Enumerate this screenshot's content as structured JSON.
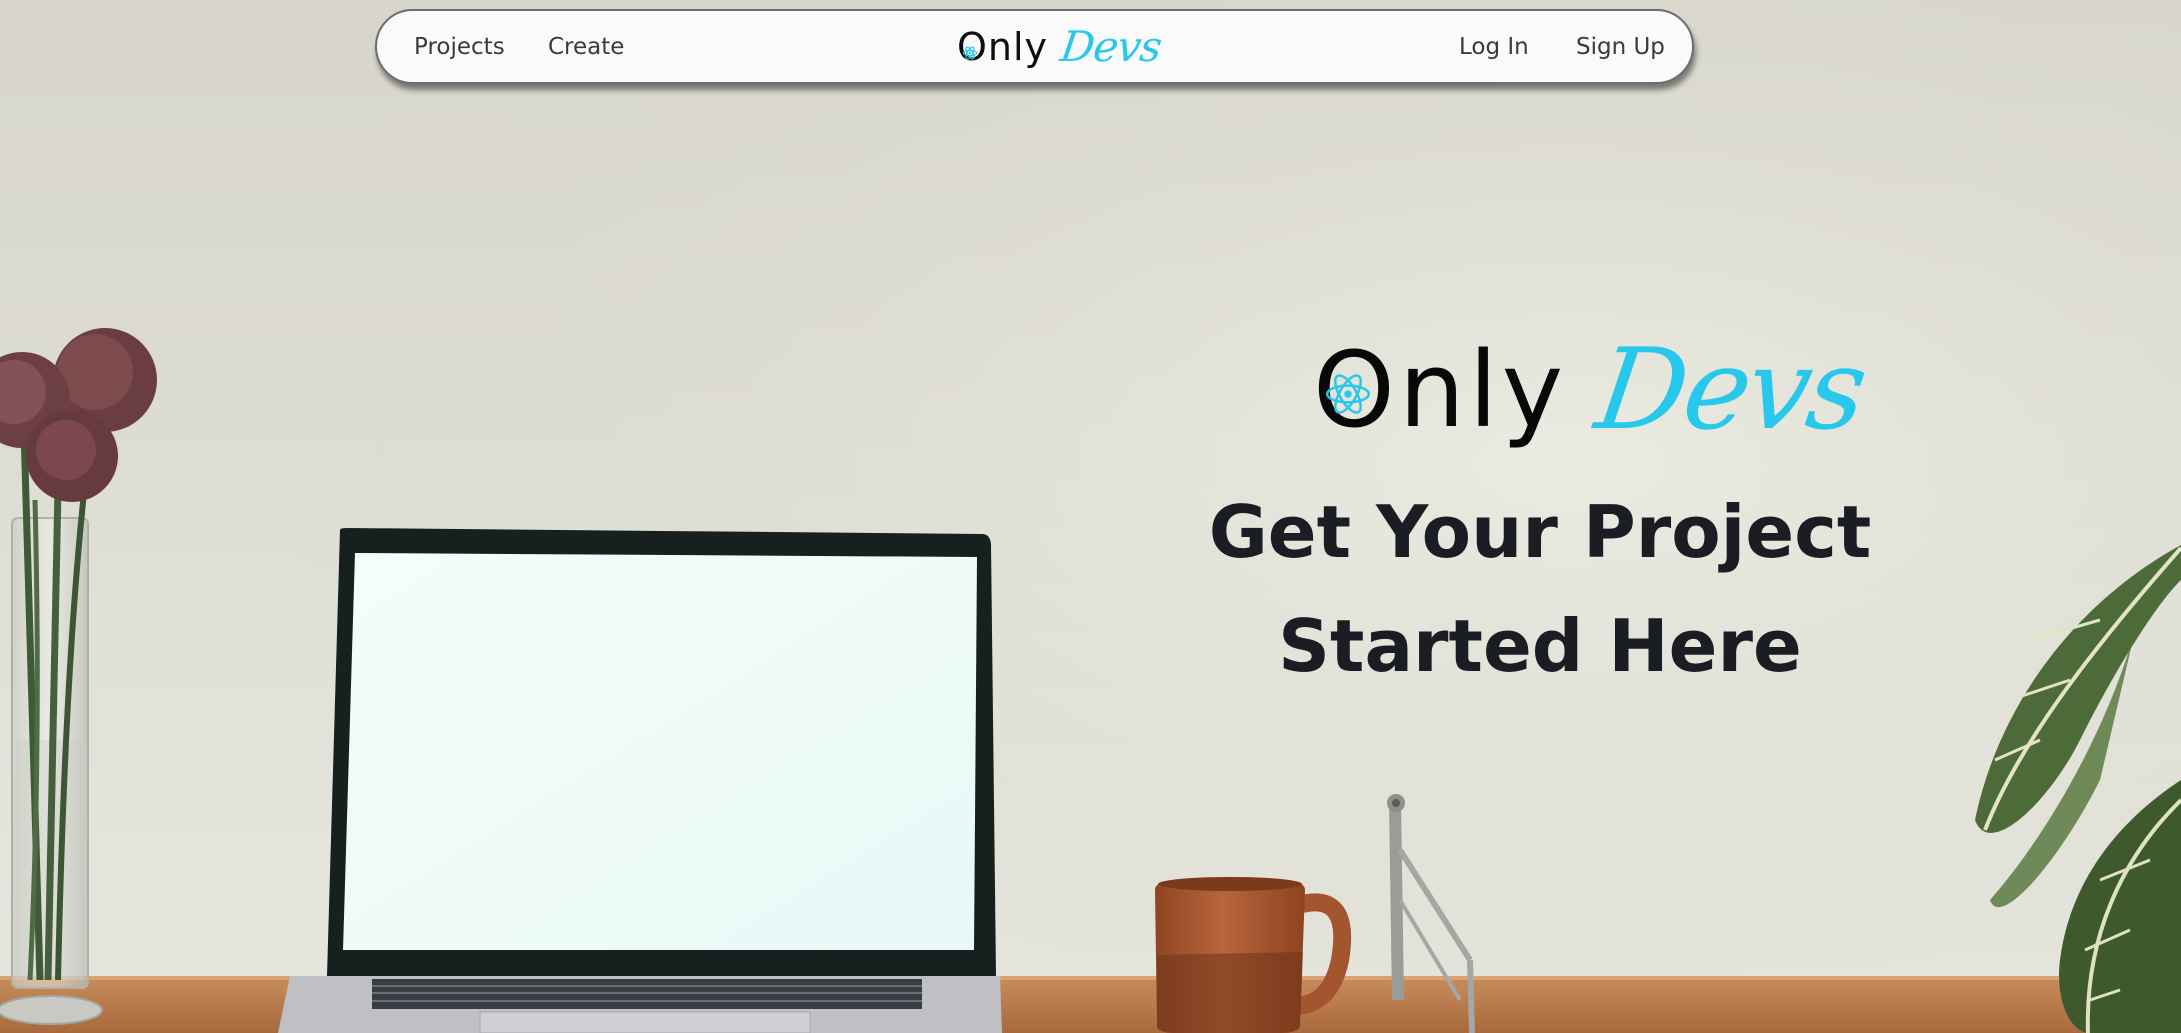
{
  "nav": {
    "projects_label": "Projects",
    "create_label": "Create",
    "login_label": "Log In",
    "signup_label": "Sign Up",
    "logo": {
      "only": "Only",
      "devs": "Devs"
    }
  },
  "hero": {
    "logo": {
      "only": "Only",
      "devs": "Devs"
    },
    "headline_line1": "Get Your Project",
    "headline_line2": "Started Here"
  },
  "colors": {
    "accent": "#27c8ec",
    "headline": "#1a1d23",
    "nav_bg": "#fafafa",
    "wall": "#dcdbd0",
    "desk": "#b77a4d"
  },
  "icons": {
    "logo_atom": "react-atom-icon"
  }
}
